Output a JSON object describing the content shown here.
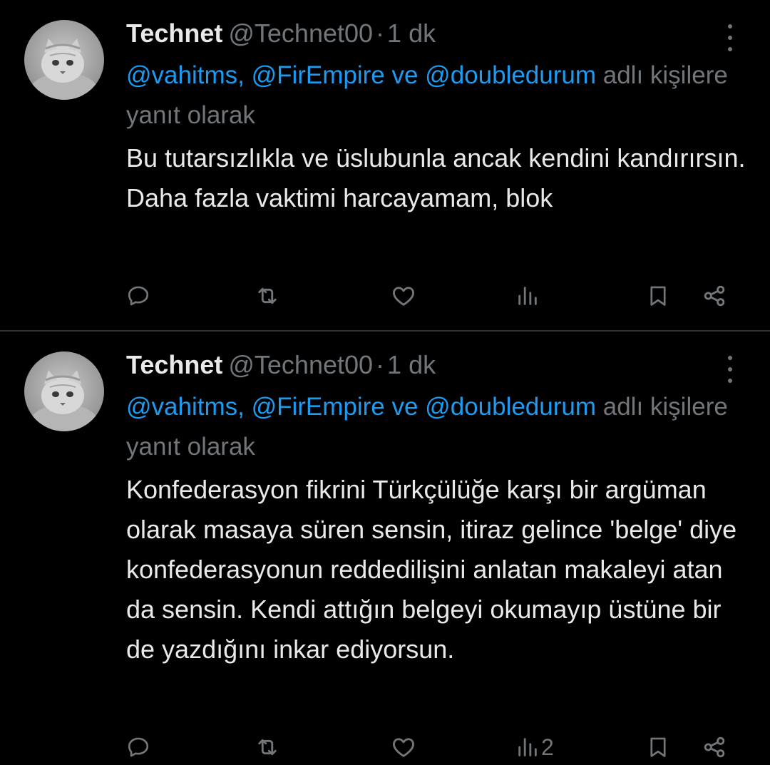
{
  "colors": {
    "background": "#000000",
    "text": "#e7e9ea",
    "secondary": "#71767b",
    "link": "#1d9bf0",
    "divider": "#2f3336"
  },
  "tweets": [
    {
      "author": {
        "name": "Technet",
        "handle": "@Technet00",
        "separator": "·",
        "time": "1 dk",
        "avatar": "cat-avatar"
      },
      "reply_to": {
        "mentions": "@vahitms, @FirEmpire ve @doubledurum",
        "suffix": " adlı kişilere yanıt olarak"
      },
      "text": "Bu tutarsızlıkla ve üslubunla ancak kendini kandırırsın. Daha fazla vaktimi harcayamam, blok",
      "actions": {
        "reply_icon": "reply-icon",
        "retweet_icon": "retweet-icon",
        "like_icon": "heart-icon",
        "views_icon": "analytics-icon",
        "views": "",
        "bookmark_icon": "bookmark-icon",
        "share_icon": "share-icon"
      }
    },
    {
      "author": {
        "name": "Technet",
        "handle": "@Technet00",
        "separator": "·",
        "time": "1 dk",
        "avatar": "cat-avatar"
      },
      "reply_to": {
        "mentions": "@vahitms, @FirEmpire ve @doubledurum",
        "suffix": " adlı kişilere yanıt olarak"
      },
      "text": "Konfederasyon fikrini Türkçülüğe karşı bir argüman olarak masaya süren sensin, itiraz gelince 'belge' diye konfederasyonun reddedilişini anlatan makaleyi atan da sensin. Kendi attığın belgeyi okumayıp üstüne bir de yazdığını inkar ediyorsun.",
      "actions": {
        "reply_icon": "reply-icon",
        "retweet_icon": "retweet-icon",
        "like_icon": "heart-icon",
        "views_icon": "analytics-icon",
        "views": "2",
        "bookmark_icon": "bookmark-icon",
        "share_icon": "share-icon"
      }
    }
  ]
}
